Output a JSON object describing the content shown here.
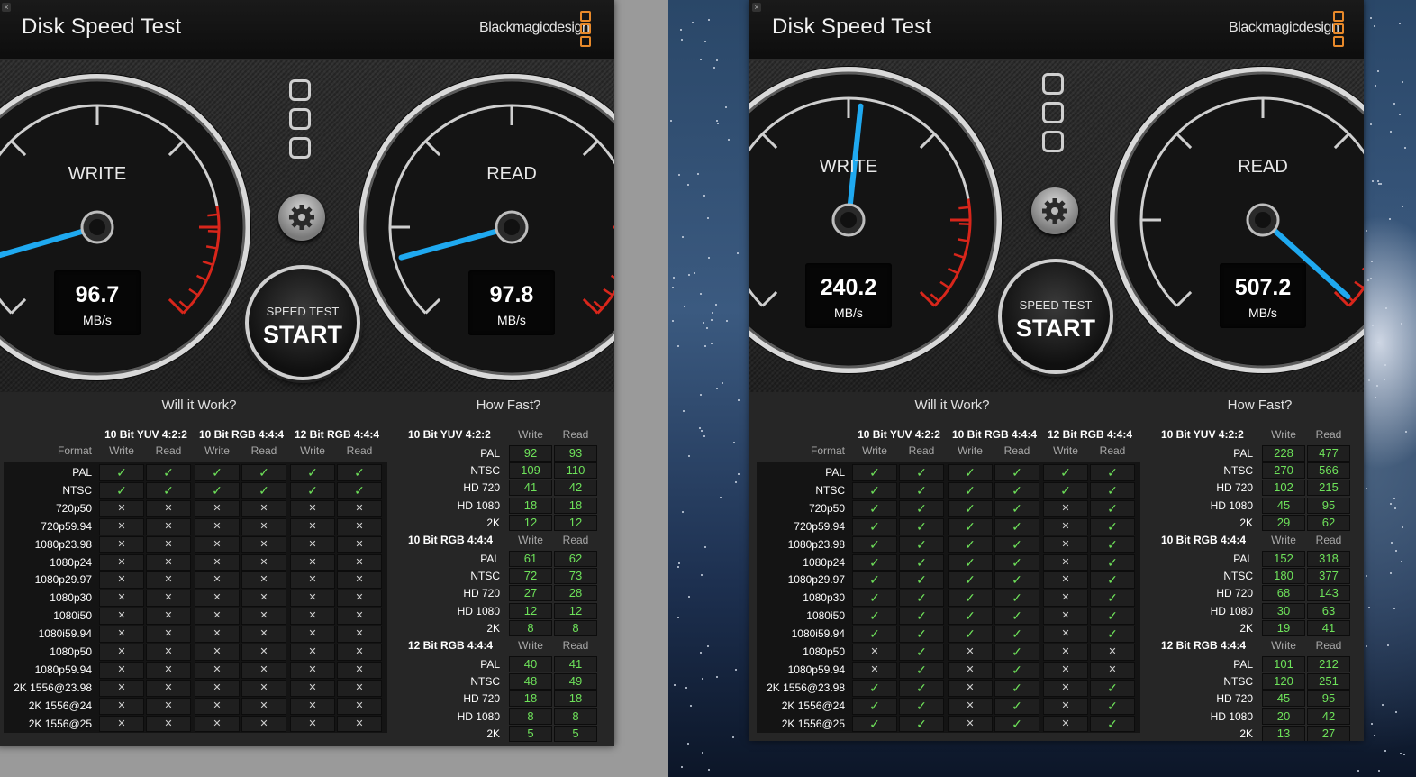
{
  "windows": [
    {
      "id": "left",
      "title": "Disk Speed Test",
      "brand": "Blackmagicdesign",
      "write": {
        "label": "WRITE",
        "value": "96.7",
        "unit": "MB/s",
        "mbps": 96.7
      },
      "read": {
        "label": "READ",
        "value": "97.8",
        "unit": "MB/s",
        "mbps": 97.8
      },
      "start": {
        "top_label": "SPEED TEST",
        "label": "START"
      },
      "will_it_work": {
        "title": "Will it Work?",
        "format_header": "Format",
        "groups": [
          "10 Bit YUV 4:2:2",
          "10 Bit RGB 4:4:4",
          "12 Bit RGB 4:4:4"
        ],
        "cols": [
          "Write",
          "Read"
        ],
        "rows": [
          {
            "format": "PAL",
            "results": [
              1,
              1,
              1,
              1,
              1,
              1
            ]
          },
          {
            "format": "NTSC",
            "results": [
              1,
              1,
              1,
              1,
              1,
              1
            ]
          },
          {
            "format": "720p50",
            "results": [
              0,
              0,
              0,
              0,
              0,
              0
            ]
          },
          {
            "format": "720p59.94",
            "results": [
              0,
              0,
              0,
              0,
              0,
              0
            ]
          },
          {
            "format": "1080p23.98",
            "results": [
              0,
              0,
              0,
              0,
              0,
              0
            ]
          },
          {
            "format": "1080p24",
            "results": [
              0,
              0,
              0,
              0,
              0,
              0
            ]
          },
          {
            "format": "1080p29.97",
            "results": [
              0,
              0,
              0,
              0,
              0,
              0
            ]
          },
          {
            "format": "1080p30",
            "results": [
              0,
              0,
              0,
              0,
              0,
              0
            ]
          },
          {
            "format": "1080i50",
            "results": [
              0,
              0,
              0,
              0,
              0,
              0
            ]
          },
          {
            "format": "1080i59.94",
            "results": [
              0,
              0,
              0,
              0,
              0,
              0
            ]
          },
          {
            "format": "1080p50",
            "results": [
              0,
              0,
              0,
              0,
              0,
              0
            ]
          },
          {
            "format": "1080p59.94",
            "results": [
              0,
              0,
              0,
              0,
              0,
              0
            ]
          },
          {
            "format": "2K 1556@23.98",
            "results": [
              0,
              0,
              0,
              0,
              0,
              0
            ]
          },
          {
            "format": "2K 1556@24",
            "results": [
              0,
              0,
              0,
              0,
              0,
              0
            ]
          },
          {
            "format": "2K 1556@25",
            "results": [
              0,
              0,
              0,
              0,
              0,
              0
            ]
          }
        ]
      },
      "how_fast": {
        "title": "How Fast?",
        "cols": [
          "Write",
          "Read"
        ],
        "groups": [
          {
            "name": "10 Bit YUV 4:2:2",
            "rows": [
              [
                "PAL",
                "92",
                "93"
              ],
              [
                "NTSC",
                "109",
                "110"
              ],
              [
                "HD 720",
                "41",
                "42"
              ],
              [
                "HD 1080",
                "18",
                "18"
              ],
              [
                "2K",
                "12",
                "12"
              ]
            ]
          },
          {
            "name": "10 Bit RGB 4:4:4",
            "rows": [
              [
                "PAL",
                "61",
                "62"
              ],
              [
                "NTSC",
                "72",
                "73"
              ],
              [
                "HD 720",
                "27",
                "28"
              ],
              [
                "HD 1080",
                "12",
                "12"
              ],
              [
                "2K",
                "8",
                "8"
              ]
            ]
          },
          {
            "name": "12 Bit RGB 4:4:4",
            "rows": [
              [
                "PAL",
                "40",
                "41"
              ],
              [
                "NTSC",
                "48",
                "49"
              ],
              [
                "HD 720",
                "18",
                "18"
              ],
              [
                "HD 1080",
                "8",
                "8"
              ],
              [
                "2K",
                "5",
                "5"
              ]
            ]
          }
        ]
      }
    },
    {
      "id": "right",
      "title": "Disk Speed Test",
      "brand": "Blackmagicdesign",
      "write": {
        "label": "WRITE",
        "value": "240.2",
        "unit": "MB/s",
        "mbps": 240.2
      },
      "read": {
        "label": "READ",
        "value": "507.2",
        "unit": "MB/s",
        "mbps": 507.2
      },
      "start": {
        "top_label": "SPEED TEST",
        "label": "START"
      },
      "will_it_work": {
        "title": "Will it Work?",
        "format_header": "Format",
        "groups": [
          "10 Bit YUV 4:2:2",
          "10 Bit RGB 4:4:4",
          "12 Bit RGB 4:4:4"
        ],
        "cols": [
          "Write",
          "Read"
        ],
        "rows": [
          {
            "format": "PAL",
            "results": [
              1,
              1,
              1,
              1,
              1,
              1
            ]
          },
          {
            "format": "NTSC",
            "results": [
              1,
              1,
              1,
              1,
              1,
              1
            ]
          },
          {
            "format": "720p50",
            "results": [
              1,
              1,
              1,
              1,
              0,
              1
            ]
          },
          {
            "format": "720p59.94",
            "results": [
              1,
              1,
              1,
              1,
              0,
              1
            ]
          },
          {
            "format": "1080p23.98",
            "results": [
              1,
              1,
              1,
              1,
              0,
              1
            ]
          },
          {
            "format": "1080p24",
            "results": [
              1,
              1,
              1,
              1,
              0,
              1
            ]
          },
          {
            "format": "1080p29.97",
            "results": [
              1,
              1,
              1,
              1,
              0,
              1
            ]
          },
          {
            "format": "1080p30",
            "results": [
              1,
              1,
              1,
              1,
              0,
              1
            ]
          },
          {
            "format": "1080i50",
            "results": [
              1,
              1,
              1,
              1,
              0,
              1
            ]
          },
          {
            "format": "1080i59.94",
            "results": [
              1,
              1,
              1,
              1,
              0,
              1
            ]
          },
          {
            "format": "1080p50",
            "results": [
              0,
              1,
              0,
              1,
              0,
              0
            ]
          },
          {
            "format": "1080p59.94",
            "results": [
              0,
              1,
              0,
              1,
              0,
              0
            ]
          },
          {
            "format": "2K 1556@23.98",
            "results": [
              1,
              1,
              0,
              1,
              0,
              1
            ]
          },
          {
            "format": "2K 1556@24",
            "results": [
              1,
              1,
              0,
              1,
              0,
              1
            ]
          },
          {
            "format": "2K 1556@25",
            "results": [
              1,
              1,
              0,
              1,
              0,
              1
            ]
          }
        ]
      },
      "how_fast": {
        "title": "How Fast?",
        "cols": [
          "Write",
          "Read"
        ],
        "groups": [
          {
            "name": "10 Bit YUV 4:2:2",
            "rows": [
              [
                "PAL",
                "228",
                "477"
              ],
              [
                "NTSC",
                "270",
                "566"
              ],
              [
                "HD 720",
                "102",
                "215"
              ],
              [
                "HD 1080",
                "45",
                "95"
              ],
              [
                "2K",
                "29",
                "62"
              ]
            ]
          },
          {
            "name": "10 Bit RGB 4:4:4",
            "rows": [
              [
                "PAL",
                "152",
                "318"
              ],
              [
                "NTSC",
                "180",
                "377"
              ],
              [
                "HD 720",
                "68",
                "143"
              ],
              [
                "HD 1080",
                "30",
                "63"
              ],
              [
                "2K",
                "19",
                "41"
              ]
            ]
          },
          {
            "name": "12 Bit RGB 4:4:4",
            "rows": [
              [
                "PAL",
                "101",
                "212"
              ],
              [
                "NTSC",
                "120",
                "251"
              ],
              [
                "HD 720",
                "45",
                "95"
              ],
              [
                "HD 1080",
                "20",
                "42"
              ],
              [
                "2K",
                "13",
                "27"
              ]
            ]
          }
        ]
      }
    }
  ],
  "icons": {
    "check": "check-icon",
    "cross": "cross-icon",
    "gear": "gear-icon",
    "close": "close-icon"
  },
  "colors": {
    "needle": "#1fa9f0",
    "ok": "#6ee25a",
    "redzone": "#d8261b",
    "logo": "#e8892a"
  }
}
